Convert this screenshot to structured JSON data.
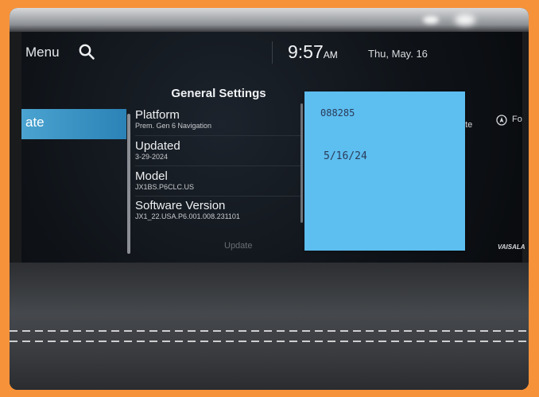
{
  "header": {
    "menu_label": "Menu",
    "time": "9:57",
    "ampm": "AM",
    "date": "Thu, May. 16"
  },
  "sidebar": {
    "selected_label": "ate"
  },
  "general_settings": {
    "title": "General Settings",
    "items": [
      {
        "label": "Platform",
        "value": "Prem. Gen 6 Navigation"
      },
      {
        "label": "Updated",
        "value": "3-29-2024"
      },
      {
        "label": "Model",
        "value": "JX1BS.P6CLC.US"
      },
      {
        "label": "Software Version",
        "value": "JX1_22.USA.P6.001.008.231101"
      }
    ],
    "update_button": "Update"
  },
  "sticky_note": {
    "line1": "088285",
    "line2": "5/16/24"
  },
  "right_panel": {
    "text1": "ate",
    "text2": "Fo"
  },
  "brand": "VAISALA",
  "icons": {
    "search": "search-icon",
    "navigation": "compass-icon"
  },
  "colors": {
    "border": "#f6923a",
    "selected": "#3a96c8",
    "note": "#5dbef0"
  }
}
